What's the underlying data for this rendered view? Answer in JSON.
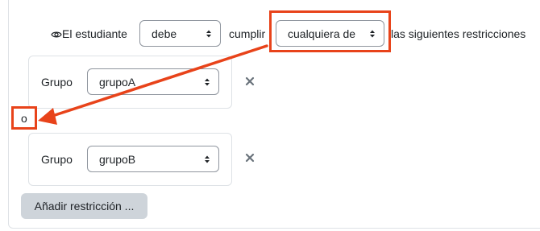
{
  "header": {
    "eye_icon_name": "eye-icon",
    "prefix": "El estudiante",
    "must_select": "debe",
    "verb": "cumplir",
    "scope_select": "cualquiera de",
    "suffix": "las siguientes restricciones"
  },
  "groups": [
    {
      "label": "Grupo",
      "value": "grupoA"
    },
    {
      "label": "Grupo",
      "value": "grupoB"
    }
  ],
  "separator": "o",
  "add_button": "Añadir restricción ...",
  "colors": {
    "annotation": "#e8431a",
    "border": "#dee2e6",
    "select_border": "#8f959e",
    "button_bg": "#ced4da"
  }
}
